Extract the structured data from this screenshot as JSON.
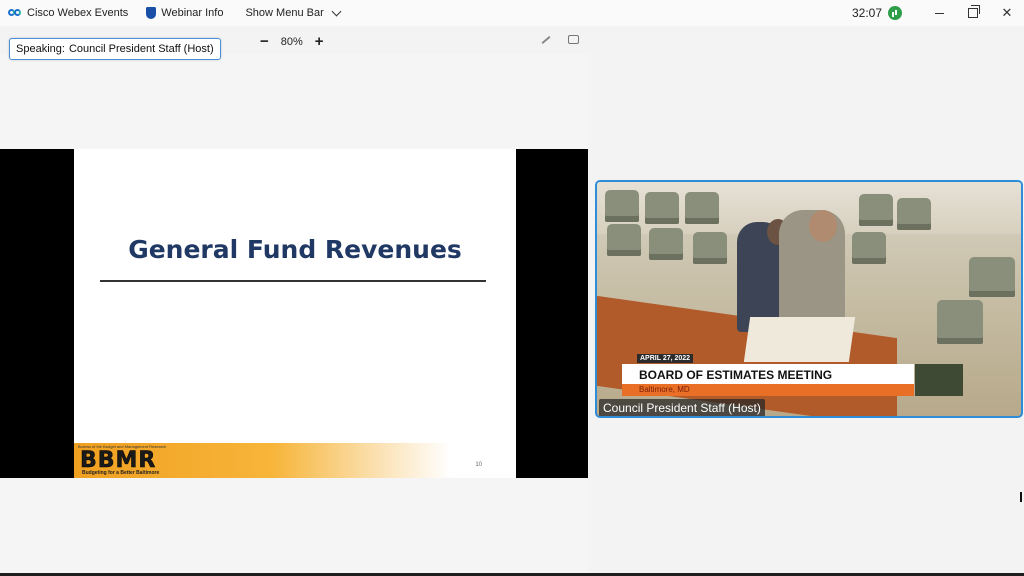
{
  "topbar": {
    "app_name": "Cisco Webex Events",
    "webinar_info": "Webinar Info",
    "show_menu_bar": "Show Menu Bar",
    "timer": "32:07"
  },
  "content": {
    "speaking_label": "Speaking:",
    "speaking_name": "Council President Staff (Host)",
    "zoom_minus": "−",
    "zoom_level": "80%",
    "zoom_plus": "+"
  },
  "slide": {
    "title": "General Fund Revenues",
    "footer_small": "Bureau of the Budget and Management Research",
    "logo_text": "BBMR",
    "tagline": "Budgeting for a Better Baltimore",
    "page_number": "10"
  },
  "video": {
    "date": "APRIL 27, 2022",
    "title": "BOARD OF ESTIMATES MEETING",
    "place": "Baltimore, MD",
    "participant_name": "Council President Staff (Host)"
  },
  "colors": {
    "accent": "#2f8dd8",
    "slide_title": "#1f3864",
    "footer_orange": "#f0a020"
  }
}
